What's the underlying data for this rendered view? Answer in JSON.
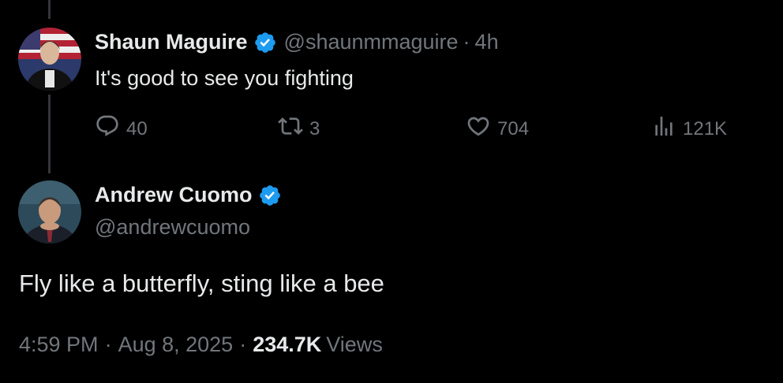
{
  "reply": {
    "author_name": "Shaun Maguire",
    "handle": "@shaunmmaguire",
    "separator": "·",
    "time": "4h",
    "text": "It's good to see you fighting",
    "actions": {
      "replies": "40",
      "reposts": "3",
      "likes": "704",
      "views": "121K"
    }
  },
  "main_tweet": {
    "author_name": "Andrew Cuomo",
    "handle": "@andrewcuomo",
    "text": "Fly like a butterfly, sting like a bee",
    "time": "4:59 PM",
    "separator1": "·",
    "date": "Aug 8, 2025",
    "separator2": "·",
    "views_count": "234.7K",
    "views_label": "Views"
  },
  "icons": {
    "verified": "verified-badge-icon",
    "reply": "reply-icon",
    "repost": "repost-icon",
    "like": "heart-icon",
    "views": "analytics-icon"
  },
  "colors": {
    "background": "#000000",
    "primary_text": "#e7e9ea",
    "secondary_text": "#71767b",
    "verified_blue": "#1d9bf0",
    "thread_line": "#333639"
  }
}
